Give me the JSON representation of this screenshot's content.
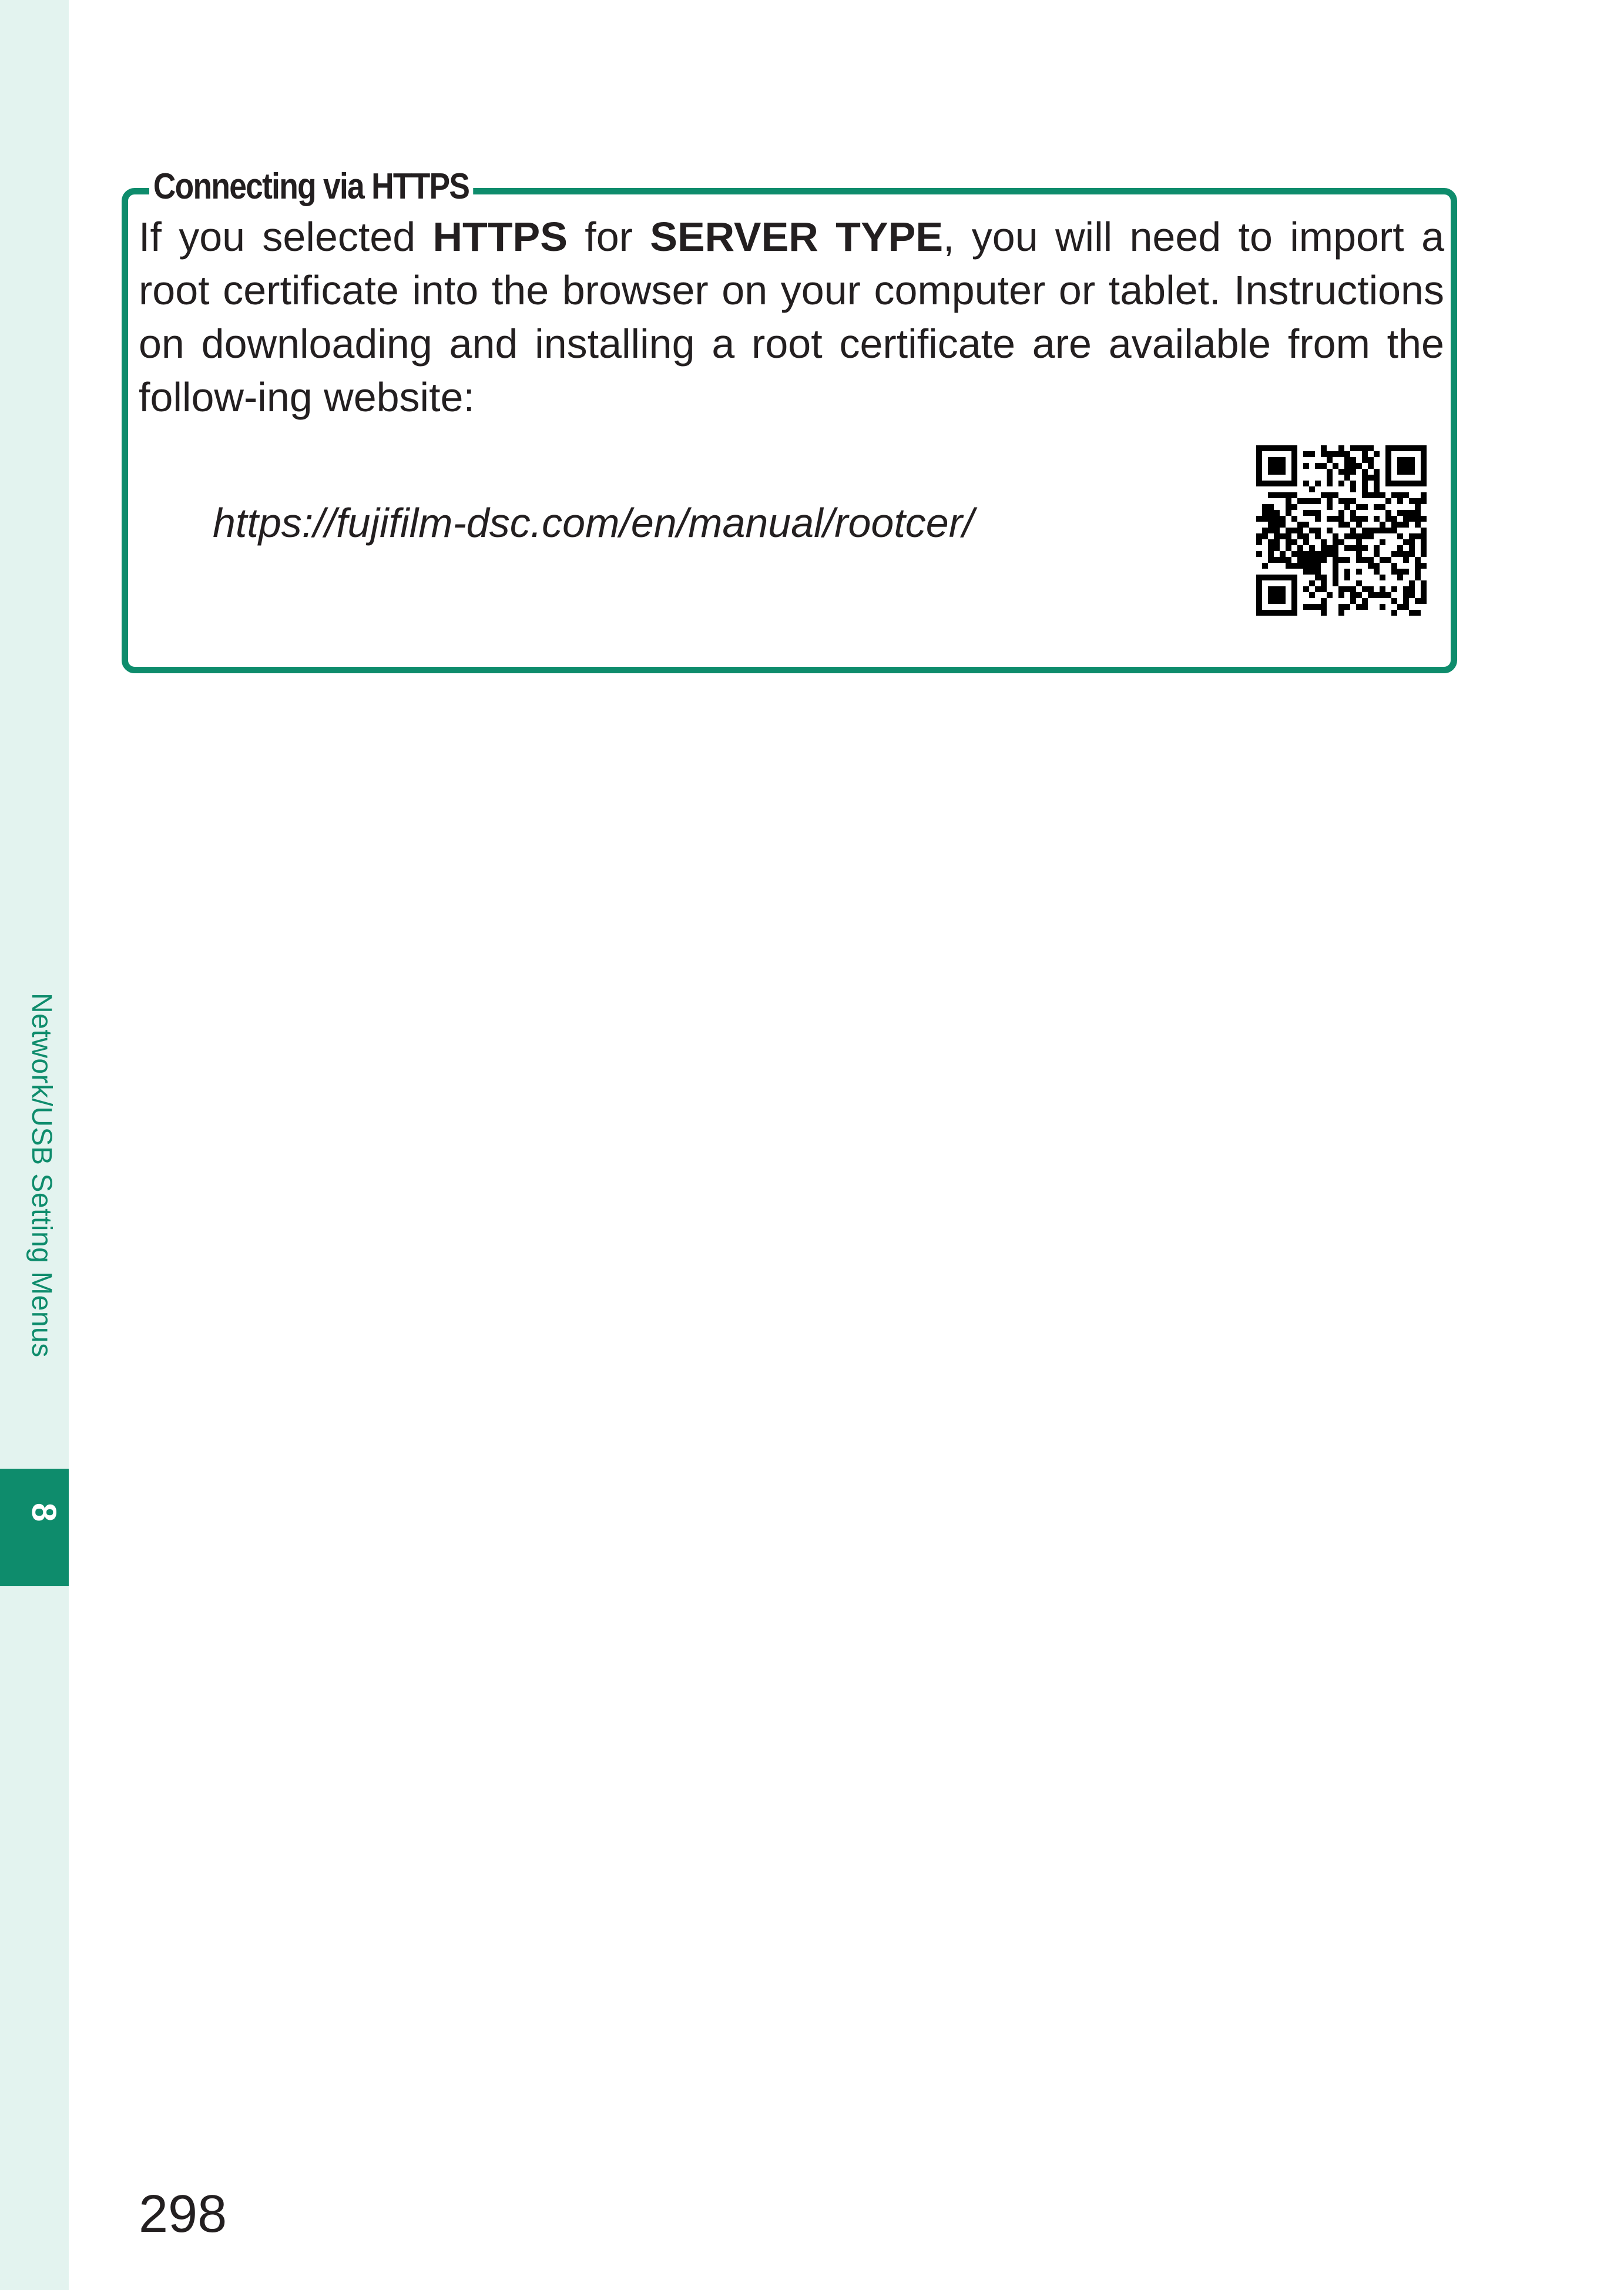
{
  "sidebar": {
    "section_label": "Network/USB Setting Menus",
    "chapter_number": "8"
  },
  "note": {
    "title": "Connecting via HTTPS",
    "body_part1": "If you selected ",
    "body_bold1": "HTTPS",
    "body_part2": " for ",
    "body_bold2": "SERVER TYPE",
    "body_part3": ", you will need to import a root certificate into the browser on your computer or tablet. Instructions on downloading and installing a root certificate are available from the follow-ing website:",
    "url": "https://fujifilm-dsc.com/en/manual/rootcer/",
    "qr_icon": "qr-code-icon"
  },
  "footer": {
    "page_number": "298"
  },
  "colors": {
    "accent": "#0e8c6c",
    "sidebar_bg": "#e3f3ef",
    "text": "#231f20"
  }
}
